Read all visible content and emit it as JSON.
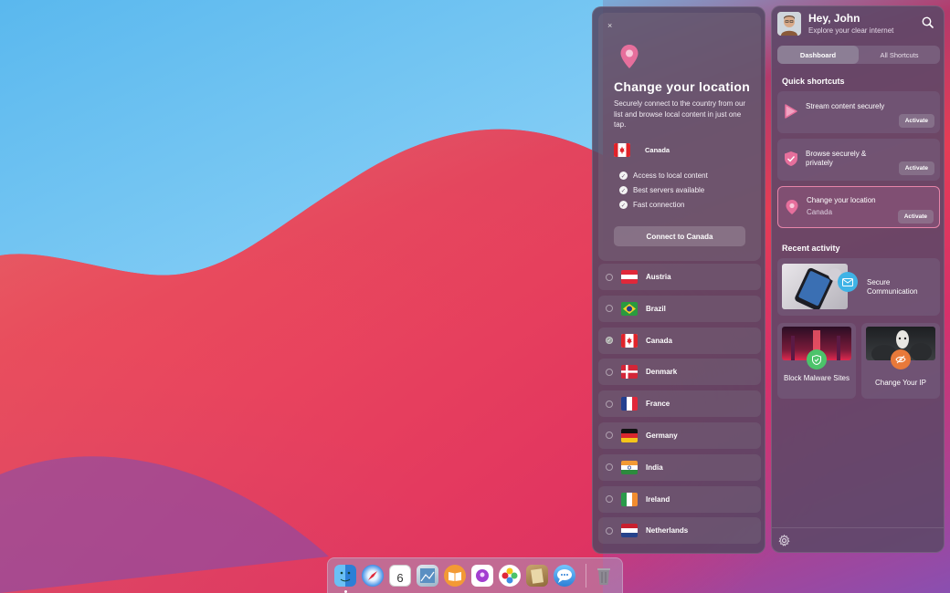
{
  "location_panel": {
    "close_label": "×",
    "title": "Change your location",
    "description": "Securely connect to the country from our list and browse local content in just one tap.",
    "selected_country": "Canada",
    "features": [
      "Access to local content",
      "Best servers available",
      "Fast connection"
    ],
    "connect_button": "Connect to Canada",
    "countries": [
      {
        "name": "Austria",
        "selected": false
      },
      {
        "name": "Brazil",
        "selected": false
      },
      {
        "name": "Canada",
        "selected": true
      },
      {
        "name": "Denmark",
        "selected": false
      },
      {
        "name": "France",
        "selected": false
      },
      {
        "name": "Germany",
        "selected": false
      },
      {
        "name": "India",
        "selected": false
      },
      {
        "name": "Ireland",
        "selected": false
      },
      {
        "name": "Netherlands",
        "selected": false
      }
    ]
  },
  "app_panel": {
    "greeting": "Hey, John",
    "subtitle": "Explore your clear internet",
    "tabs": [
      {
        "label": "Dashboard",
        "active": true
      },
      {
        "label": "All Shortcuts",
        "active": false
      }
    ],
    "quick_shortcuts_title": "Quick shortcuts",
    "shortcuts": [
      {
        "title": "Stream content securely",
        "subtitle": "",
        "button": "Activate",
        "icon": "play-icon"
      },
      {
        "title": "Browse securely & privately",
        "subtitle": "",
        "button": "Activate",
        "icon": "shield-icon"
      },
      {
        "title": "Change your location",
        "subtitle": "Canada",
        "button": "Activate",
        "icon": "location-pin-icon",
        "active": true
      }
    ],
    "recent_activity_title": "Recent activity",
    "recent": [
      {
        "label": "Secure Communication"
      },
      {
        "label": "Block Malware Sites"
      },
      {
        "label": "Change Your IP"
      }
    ]
  },
  "dock": {
    "calendar_day": "6",
    "apps": [
      "finder",
      "safari",
      "calendar",
      "preview",
      "books",
      "podcasts",
      "photos",
      "notes",
      "messages",
      "trash"
    ]
  },
  "colors": {
    "accent_pink": "#e785a9",
    "check_green": "#4cc36a",
    "orange": "#e8793a"
  }
}
